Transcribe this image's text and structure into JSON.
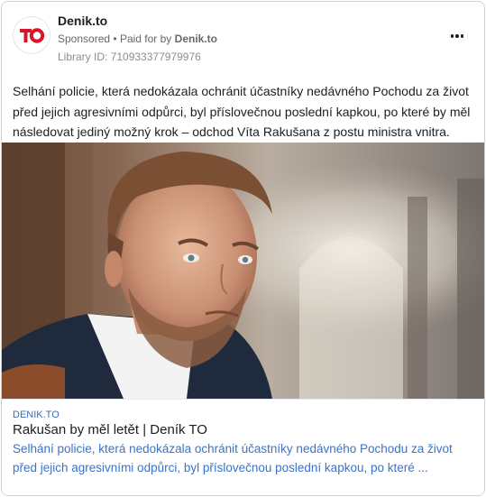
{
  "ad": {
    "page_name": "Denik.to",
    "sponsored_label": "Sponsored",
    "separator": "•",
    "paid_for_prefix": "Paid for by",
    "paid_for_name": "Denik.to",
    "library_id": "Library ID: 710933377979976",
    "logo_text": "TO",
    "body": "Selhání policie, která nedokázala ochránit účastníky nedávného Pochodu za život před jejich agresivními odpůrci, byl příslovečnou poslední kapkou, po které by měl následovat jediný možný krok – odchod Víta Rakušana z postu ministra vnitra."
  },
  "link": {
    "domain": "DENIK.TO",
    "title": "Rakušan by měl letět | Deník TO",
    "description": "Selhání policie, která nedokázala ochránit účastníky nedávného Pochodu za život před jejich agresivními odpůrci, byl příslovečnou poslední kapkou, po které ..."
  },
  "icons": {
    "logo": "denik-to-logo",
    "more": "more-options-icon"
  },
  "colors": {
    "brand_red": "#d7142a",
    "link_blue": "#3b73c8",
    "text": "#1c1e21",
    "muted": "#65676b"
  }
}
